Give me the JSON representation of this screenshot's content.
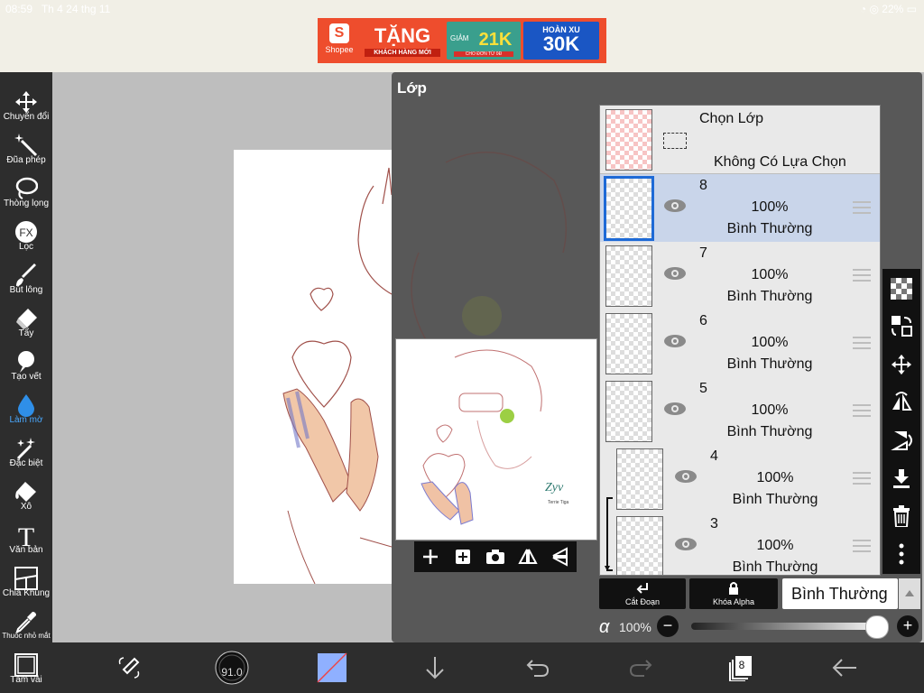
{
  "status": {
    "time": "08:59",
    "date": "Th 4 24 thg 11",
    "battery": "22%"
  },
  "ad": {
    "brand": "Shopee",
    "headline": "TẶNG",
    "sub": "KHÁCH HÀNG MỚI",
    "discount_label": "GIẢM",
    "discount": "21K",
    "min_order": "CHO ĐƠN TỪ 0Đ",
    "cashback_label": "HOÀN XU",
    "cashback": "30K"
  },
  "left_toolbar": [
    {
      "label": "Chuyển đổi",
      "icon": "move-icon"
    },
    {
      "label": "Đũa phép",
      "icon": "magic-wand-icon"
    },
    {
      "label": "Thòng lọng",
      "icon": "lasso-icon"
    },
    {
      "label": "Lọc",
      "icon": "fx-icon"
    },
    {
      "label": "Bút lông",
      "icon": "brush-icon"
    },
    {
      "label": "Tẩy",
      "icon": "eraser-icon"
    },
    {
      "label": "Tạo vết",
      "icon": "smudge-icon"
    },
    {
      "label": "Làm mờ",
      "icon": "blur-drop-icon",
      "active": true
    },
    {
      "label": "Đặc biệt",
      "icon": "special-icon"
    },
    {
      "label": "Xô",
      "icon": "bucket-icon"
    },
    {
      "label": "Văn bản",
      "icon": "text-icon"
    },
    {
      "label": "Chia Khung",
      "icon": "frame-divider-icon"
    },
    {
      "label": "Thuốc nhỏ mắt",
      "icon": "eyedropper-icon"
    },
    {
      "label": "Tấm vải",
      "icon": "canvas-icon"
    }
  ],
  "layer_panel": {
    "title": "Lớp",
    "selection": {
      "title": "Chọn Lớp",
      "status": "Không Có Lựa Chọn"
    },
    "layers": [
      {
        "num": "8",
        "opacity": "100%",
        "blend": "Bình Thường",
        "selected": true
      },
      {
        "num": "7",
        "opacity": "100%",
        "blend": "Bình Thường"
      },
      {
        "num": "6",
        "opacity": "100%",
        "blend": "Bình Thường"
      },
      {
        "num": "5",
        "opacity": "100%",
        "blend": "Bình Thường"
      },
      {
        "num": "4",
        "opacity": "100%",
        "blend": "Bình Thường",
        "clipped": true
      },
      {
        "num": "3",
        "opacity": "100%",
        "blend": "Bình Thường",
        "clipped": true
      }
    ],
    "clip_label": "Cắt Đoạn",
    "alpha_lock_label": "Khóa Alpha",
    "blend_mode": "Bình Thường",
    "alpha_symbol": "α",
    "opacity": "100%",
    "opacity_fraction": 1.0,
    "preview_signature": "Terrie Tiga"
  },
  "right_toolbar": [
    "checker-icon",
    "layer-transfer-icon",
    "move-layer-icon",
    "flip-horizontal-icon",
    "flip-vertical-icon",
    "merge-down-icon",
    "trash-icon",
    "more-icon"
  ],
  "bottom_toolbar": {
    "brush_size": "91.0",
    "layer_count": "8"
  }
}
